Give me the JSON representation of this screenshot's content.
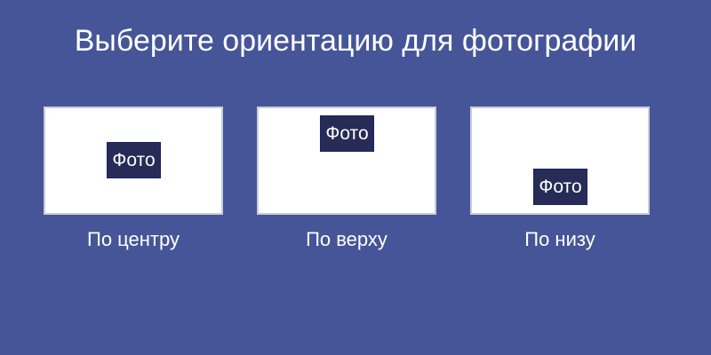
{
  "dialog": {
    "title": "Выберите ориентацию для фотографии"
  },
  "options": [
    {
      "label": "По центру",
      "photo_label": "Фото"
    },
    {
      "label": "По верху",
      "photo_label": "Фото"
    },
    {
      "label": "По низу",
      "photo_label": "Фото"
    }
  ],
  "colors": {
    "background": "#455597",
    "preview_background": "#ffffff",
    "preview_border": "#c9cdd8",
    "photo_fill": "#262c55",
    "text": "#ffffff"
  }
}
